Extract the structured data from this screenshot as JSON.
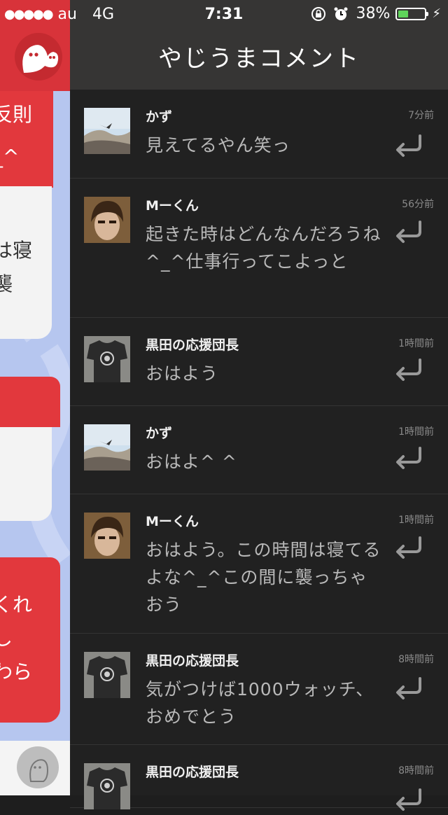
{
  "status_bar": {
    "signal": "●●●●●",
    "carrier": "au",
    "network": "4G",
    "time": "7:31",
    "battery": "38%",
    "battery_level": 0.38
  },
  "header": {
    "title": "やじうまコメント"
  },
  "background_app": {
    "fragments": [
      "反則",
      "_^",
      "は寝\n襲",
      "くれ\nし\nわら"
    ]
  },
  "comments": [
    {
      "user": "かず",
      "time": "7分前",
      "text": "見えてるやん笑っ",
      "avatar": "photo-landscape"
    },
    {
      "user": "Mーくん",
      "time": "56分前",
      "text": "起きた時はどんなんだろうね^_^仕事行ってこよっと",
      "avatar": "photo-person"
    },
    {
      "user": "黒田の応援団長",
      "time": "1時間前",
      "text": "おはよう",
      "avatar": "photo-tshirt"
    },
    {
      "user": "かず",
      "time": "1時間前",
      "text": "おはよ^ ^",
      "avatar": "photo-landscape"
    },
    {
      "user": "Mーくん",
      "time": "1時間前",
      "text": "おはよう。この時間は寝てるよな^_^この間に襲っちゃおう",
      "avatar": "photo-person"
    },
    {
      "user": "黒田の応援団長",
      "time": "8時間前",
      "text": "気がつけば1000ウォッチ、おめでとう",
      "avatar": "photo-tshirt"
    },
    {
      "user": "黒田の応援団長",
      "time": "8時間前",
      "text": "",
      "avatar": "photo-tshirt"
    }
  ],
  "colors": {
    "accent_red": "#e2383d",
    "panel_bg": "#212121",
    "header_bg": "#363534"
  }
}
